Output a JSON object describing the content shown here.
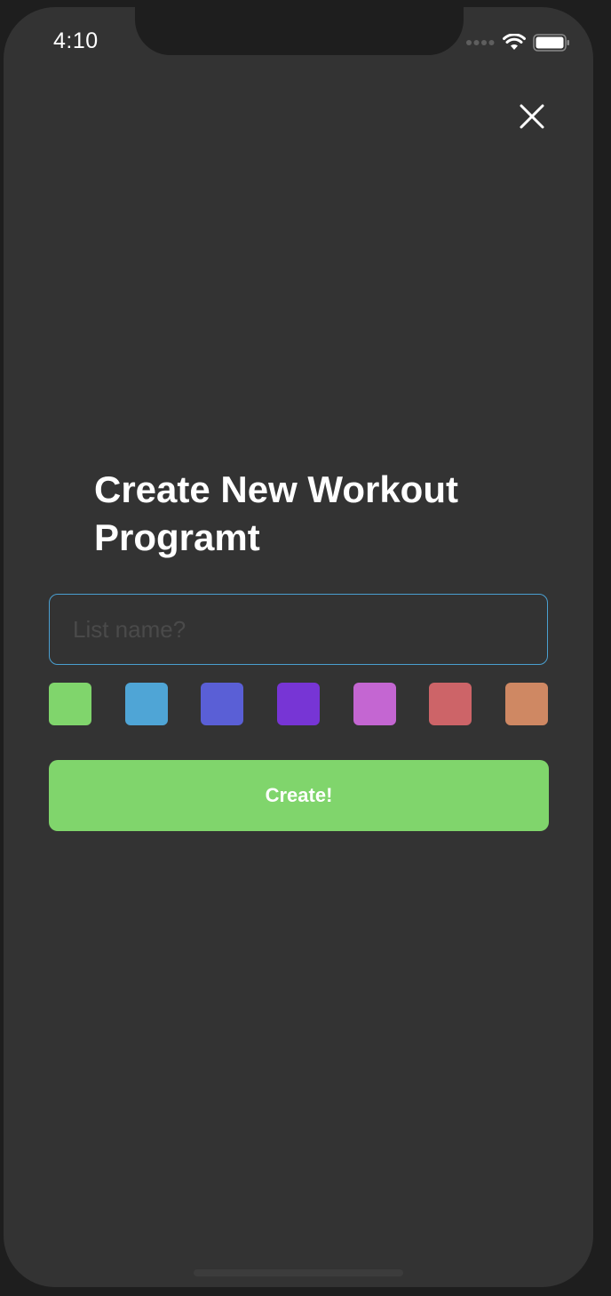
{
  "status_bar": {
    "time": "4:10",
    "icons": [
      "signal-dots-icon",
      "wifi-icon",
      "battery-icon"
    ]
  },
  "close_icon": "close-icon",
  "title": "Create New Workout Programt",
  "name_input": {
    "placeholder": "List name?",
    "value": ""
  },
  "swatches": [
    {
      "color": "#80d56c"
    },
    {
      "color": "#4fa5d6"
    },
    {
      "color": "#5a5fd6"
    },
    {
      "color": "#7735d5"
    },
    {
      "color": "#c466d2"
    },
    {
      "color": "#cd6468"
    },
    {
      "color": "#cf8863"
    }
  ],
  "create_button": {
    "label": "Create!",
    "color": "#80d56c"
  },
  "colors": {
    "background": "#333333",
    "input_border": "#4a9fd0"
  }
}
